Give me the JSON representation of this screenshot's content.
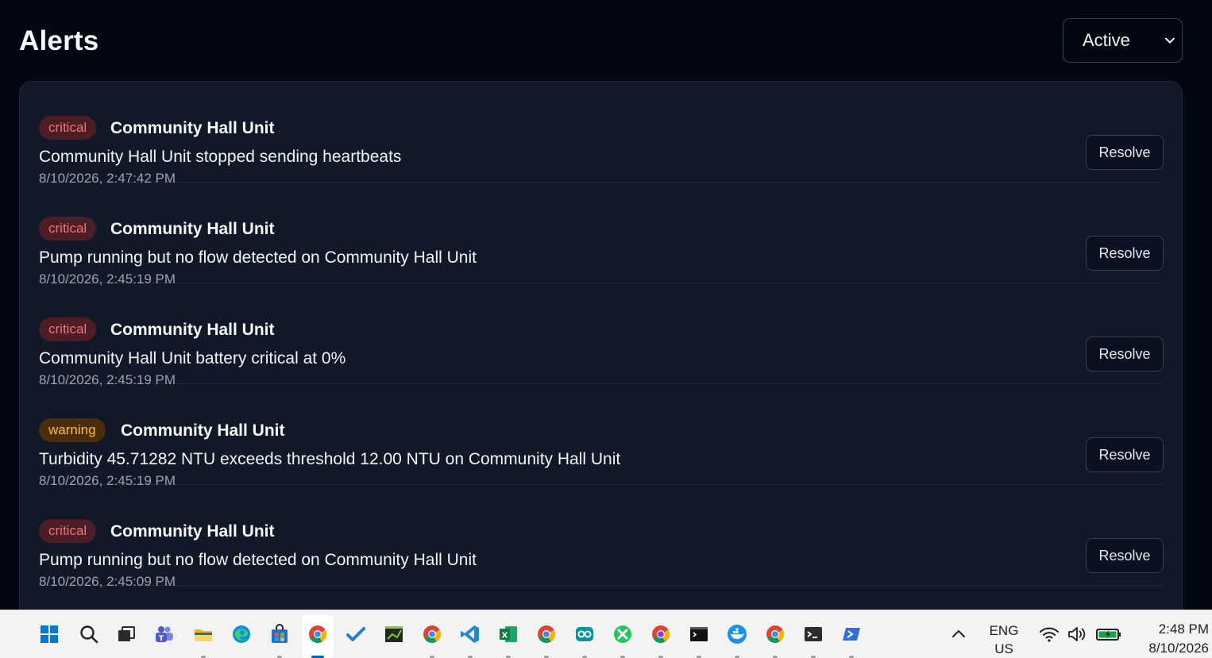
{
  "header": {
    "title": "Alerts"
  },
  "filter": {
    "selected": "Active"
  },
  "alerts": [
    {
      "severity": "critical",
      "device": "Community Hall Unit",
      "message": "Community Hall Unit stopped sending heartbeats",
      "timestamp": "8/10/2026, 2:47:42 PM",
      "action": "Resolve"
    },
    {
      "severity": "critical",
      "device": "Community Hall Unit",
      "message": "Pump running but no flow detected on Community Hall Unit",
      "timestamp": "8/10/2026, 2:45:19 PM",
      "action": "Resolve"
    },
    {
      "severity": "critical",
      "device": "Community Hall Unit",
      "message": "Community Hall Unit battery critical at 0%",
      "timestamp": "8/10/2026, 2:45:19 PM",
      "action": "Resolve"
    },
    {
      "severity": "warning",
      "device": "Community Hall Unit",
      "message": "Turbidity 45.71282 NTU exceeds threshold 12.00 NTU on Community Hall Unit",
      "timestamp": "8/10/2026, 2:45:19 PM",
      "action": "Resolve"
    },
    {
      "severity": "critical",
      "device": "Community Hall Unit",
      "message": "Pump running but no flow detected on Community Hall Unit",
      "timestamp": "8/10/2026, 2:45:09 PM",
      "action": "Resolve"
    }
  ],
  "colors": {
    "critical_bg": "#4c1d24",
    "critical_text": "#f87171",
    "warning_bg": "#4a2d0c",
    "warning_text": "#fbbf24",
    "panel": "#111827",
    "background": "#030712"
  },
  "taskbar": {
    "icons": [
      "windows-start-icon",
      "search-icon",
      "task-view-icon",
      "teams-icon",
      "file-explorer-icon",
      "edge-icon",
      "store-icon",
      "chrome-icon",
      "todo-icon",
      "terminal-app-icon",
      "chrome-icon",
      "vscode-icon",
      "excel-icon",
      "chrome-icon",
      "arduino-icon",
      "app-icon",
      "chrome-icon",
      "console-icon",
      "docker-icon",
      "chrome-icon",
      "terminal-icon",
      "powershell-icon"
    ],
    "language": "ENG",
    "region": "US",
    "time": "2:48 PM",
    "date": "8/10/2026"
  }
}
